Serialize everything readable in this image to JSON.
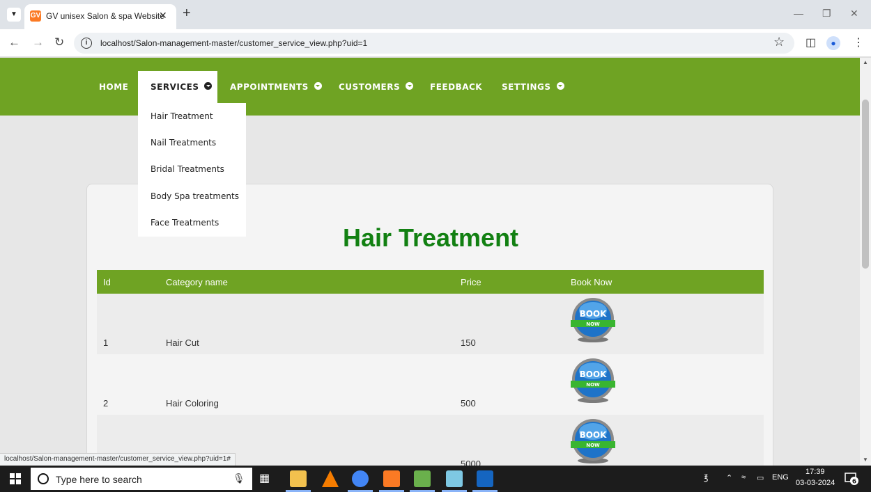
{
  "browser": {
    "tab_title": "GV unisex Salon & spa Website",
    "tab_favicon_letter": "GV",
    "url": "localhost/Salon-management-master/customer_service_view.php?uid=1",
    "status_url": "localhost/Salon-management-master/customer_service_view.php?uid=1#"
  },
  "nav": {
    "home": "HOME",
    "services": "SERVICES",
    "appointments": "APPOINTMENTS",
    "customers": "CUSTOMERS",
    "feedback": "FEEDBACK",
    "settings": "SETTINGS"
  },
  "dropdown": [
    "Hair Treatment",
    "Nail Treatments",
    "Bridal Treatments",
    "Body Spa treatments",
    "Face Treatments"
  ],
  "page": {
    "title": "Hair Treatment",
    "columns": [
      "Id",
      "Category name",
      "Price",
      "Book Now"
    ],
    "rows": [
      {
        "id": "1",
        "name": "Hair Cut",
        "price": "150"
      },
      {
        "id": "2",
        "name": "Hair Coloring",
        "price": "500"
      },
      {
        "id": "",
        "name": "",
        "price": "5000"
      }
    ],
    "book_label_top": "BOOK",
    "book_label_bottom": "NOW"
  },
  "taskbar": {
    "search_placeholder": "Type here to search",
    "language": "ENG",
    "time": "17:39",
    "date": "03-03-2024",
    "notification_count": "6"
  },
  "colors": {
    "nav_green": "#6fa323",
    "title_green": "#128012"
  }
}
